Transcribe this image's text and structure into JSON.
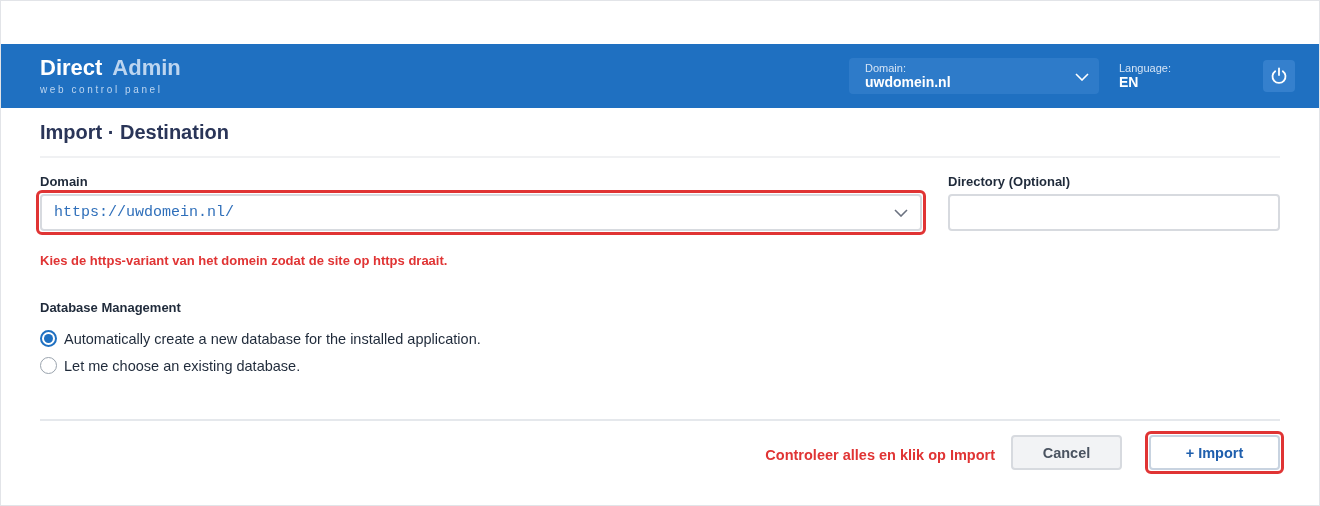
{
  "header": {
    "brand": {
      "first": "Direct",
      "second": "Admin",
      "tagline": "web control panel"
    },
    "domain_select": {
      "label": "Domain:",
      "value": "uwdomein.nl"
    },
    "language": {
      "label": "Language:",
      "value": "EN"
    }
  },
  "page_title": "Import · Destination",
  "fields": [
    {
      "kind": "select",
      "label": "Domain",
      "value": "https://uwdomein.nl/",
      "highlighted": true
    },
    {
      "kind": "text",
      "label": "Directory (Optional)",
      "highlighted": false
    }
  ],
  "hint": "Kies de https-variant van het domein zodat de site op https draait.",
  "database": {
    "heading": "Database Management",
    "options": [
      {
        "label": "Automatically create a new database for the installed application.",
        "selected": true
      },
      {
        "label": "Let me choose an existing database.",
        "selected": false
      }
    ]
  },
  "footer": {
    "note": "Controleer alles en klik op Import",
    "buttons": [
      {
        "kind": "secondary",
        "label": "Cancel",
        "highlighted": false
      },
      {
        "kind": "primary",
        "label": "+ Import",
        "highlighted": true
      }
    ]
  }
}
